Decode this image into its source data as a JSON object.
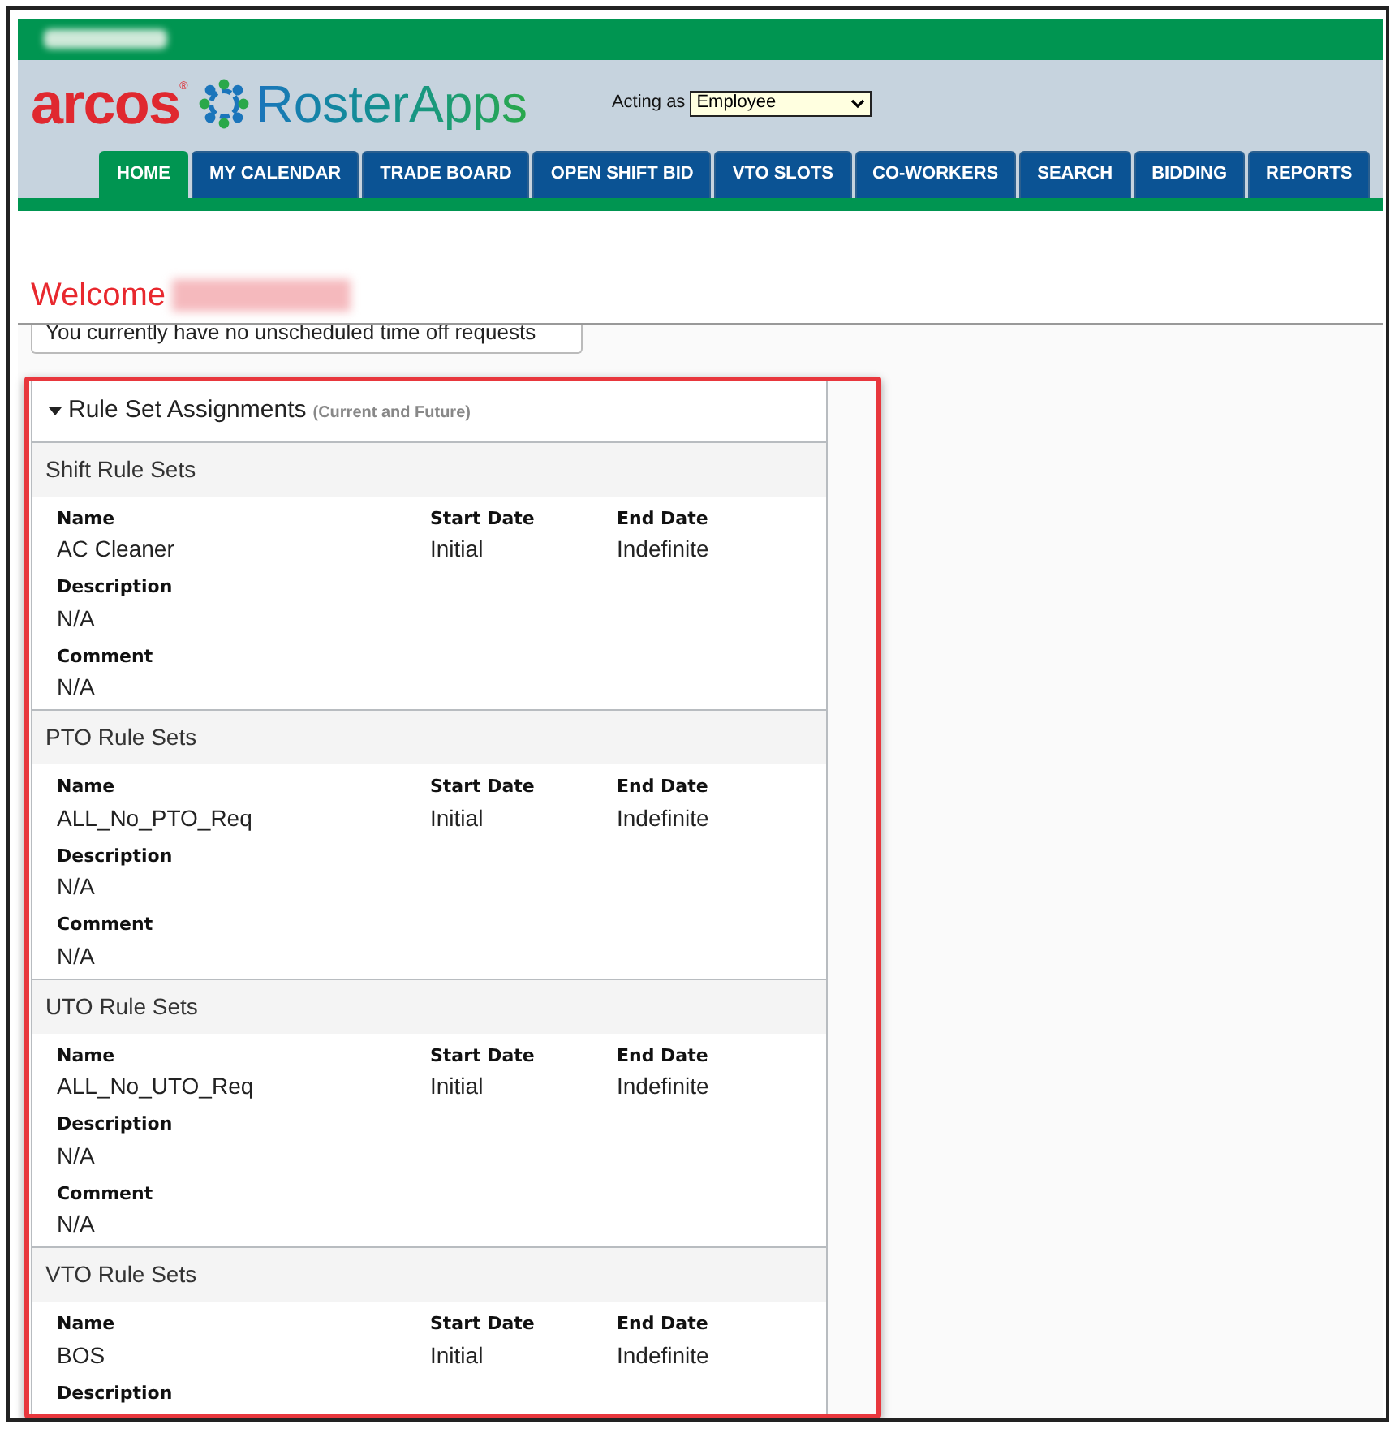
{
  "header": {
    "brand": "arcos",
    "brand_mark": "®",
    "product": "RosterApps",
    "acting_as": {
      "label": "Acting as",
      "value": "Employee"
    }
  },
  "tabs": [
    {
      "label": "HOME",
      "selected": true
    },
    {
      "label": "MY CALENDAR",
      "selected": false
    },
    {
      "label": "TRADE BOARD",
      "selected": false
    },
    {
      "label": "OPEN SHIFT BID",
      "selected": false
    },
    {
      "label": "VTO SLOTS",
      "selected": false
    },
    {
      "label": "CO-WORKERS",
      "selected": false
    },
    {
      "label": "SEARCH",
      "selected": false
    },
    {
      "label": "BIDDING",
      "selected": false
    },
    {
      "label": "REPORTS",
      "selected": false
    }
  ],
  "welcome": "Welcome",
  "notice": "You currently have no unscheduled time off requests",
  "panel": {
    "title": "Rule Set Assignments",
    "subtitle": "(Current and Future)",
    "expanded": true,
    "sections": [
      {
        "title": "Shift Rule Sets",
        "columns": [
          {
            "label": "Name",
            "value": "AC Cleaner"
          },
          {
            "label": "Start Date",
            "value": "Initial"
          },
          {
            "label": "End Date",
            "value": "Indefinite"
          }
        ],
        "details": [
          {
            "label": "Description",
            "value": "N/A"
          },
          {
            "label": "Comment",
            "value": "N/A"
          }
        ]
      },
      {
        "title": "PTO Rule Sets",
        "columns": [
          {
            "label": "Name",
            "value": "ALL_No_PTO_Req"
          },
          {
            "label": "Start Date",
            "value": "Initial"
          },
          {
            "label": "End Date",
            "value": "Indefinite"
          }
        ],
        "details": [
          {
            "label": "Description",
            "value": "N/A"
          },
          {
            "label": "Comment",
            "value": "N/A"
          }
        ]
      },
      {
        "title": "UTO Rule Sets",
        "columns": [
          {
            "label": "Name",
            "value": "ALL_No_UTO_Req"
          },
          {
            "label": "Start Date",
            "value": "Initial"
          },
          {
            "label": "End Date",
            "value": "Indefinite"
          }
        ],
        "details": [
          {
            "label": "Description",
            "value": "N/A"
          },
          {
            "label": "Comment",
            "value": "N/A"
          }
        ]
      },
      {
        "title": "VTO Rule Sets",
        "columns": [
          {
            "label": "Name",
            "value": "BOS"
          },
          {
            "label": "Start Date",
            "value": "Initial"
          },
          {
            "label": "End Date",
            "value": "Indefinite"
          }
        ],
        "details": [
          {
            "label": "Description"
          }
        ]
      }
    ]
  }
}
